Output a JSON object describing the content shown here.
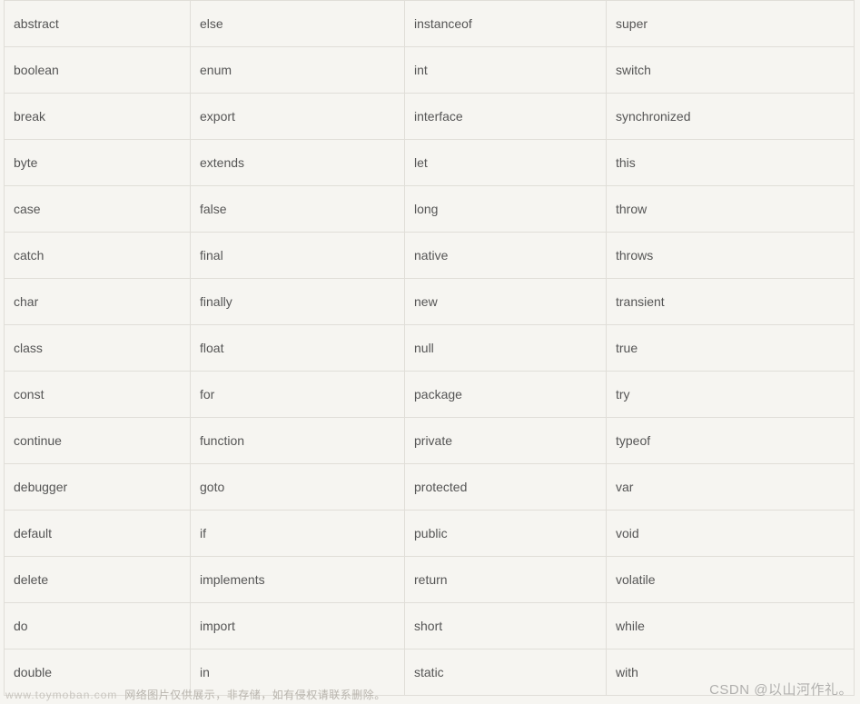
{
  "table": {
    "rows": [
      [
        "abstract",
        "else",
        "instanceof",
        "super"
      ],
      [
        "boolean",
        "enum",
        "int",
        "switch"
      ],
      [
        "break",
        "export",
        "interface",
        "synchronized"
      ],
      [
        "byte",
        "extends",
        "let",
        "this"
      ],
      [
        "case",
        "false",
        "long",
        "throw"
      ],
      [
        "catch",
        "final",
        "native",
        "throws"
      ],
      [
        "char",
        "finally",
        "new",
        "transient"
      ],
      [
        "class",
        "float",
        "null",
        "true"
      ],
      [
        "const",
        "for",
        "package",
        "try"
      ],
      [
        "continue",
        "function",
        "private",
        "typeof"
      ],
      [
        "debugger",
        "goto",
        "protected",
        "var"
      ],
      [
        "default",
        "if",
        "public",
        "void"
      ],
      [
        "delete",
        "implements",
        "return",
        "volatile"
      ],
      [
        "do",
        "import",
        "short",
        "while"
      ],
      [
        "double",
        "in",
        "static",
        "with"
      ]
    ]
  },
  "footer": {
    "domain": "www.toymoban.com",
    "text": "网络图片仅供展示，非存储，如有侵权请联系删除。"
  },
  "watermark": "CSDN @以山河作礼。"
}
